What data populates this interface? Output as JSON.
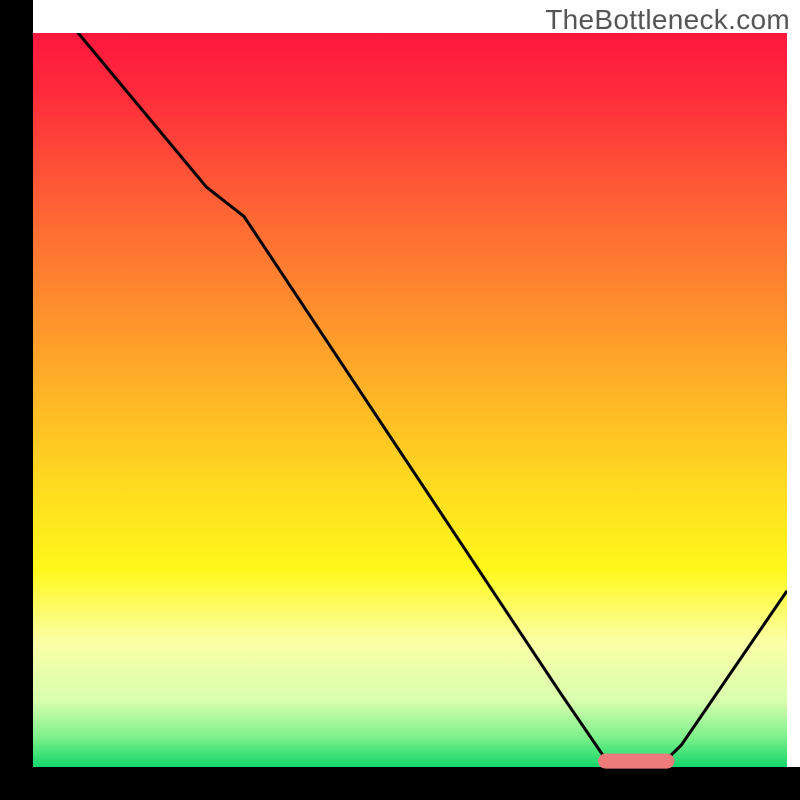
{
  "watermark": "TheBottleneck.com",
  "colors": {
    "frame_black": "#000000",
    "gradient_stops": [
      {
        "offset": 0.0,
        "color": "#ff173e"
      },
      {
        "offset": 0.08,
        "color": "#ff2b3c"
      },
      {
        "offset": 0.26,
        "color": "#ff6a34"
      },
      {
        "offset": 0.43,
        "color": "#ffa02a"
      },
      {
        "offset": 0.6,
        "color": "#ffd620"
      },
      {
        "offset": 0.73,
        "color": "#fff81a"
      },
      {
        "offset": 0.83,
        "color": "#fbffa6"
      },
      {
        "offset": 0.91,
        "color": "#d8ffae"
      },
      {
        "offset": 0.96,
        "color": "#7cf08a"
      },
      {
        "offset": 1.0,
        "color": "#13d76a"
      }
    ],
    "curve": "#000000",
    "marker_fill": "#ee7b7b",
    "marker_stroke": "#ee7b7b"
  },
  "chart_data": {
    "type": "line",
    "title": "",
    "xlabel": "",
    "ylabel": "",
    "xlim": [
      0,
      100
    ],
    "ylim": [
      0,
      100
    ],
    "grid": false,
    "series": [
      {
        "name": "bottleneck-curve",
        "x": [
          0,
          6,
          23,
          28,
          70,
          76,
          84,
          86,
          100
        ],
        "values": [
          110,
          100,
          79,
          75,
          10,
          1,
          1,
          3,
          24
        ]
      }
    ],
    "marker": {
      "name": "optimal-band",
      "x_start": 75,
      "x_end": 85,
      "y": 0.8
    },
    "annotations": []
  }
}
